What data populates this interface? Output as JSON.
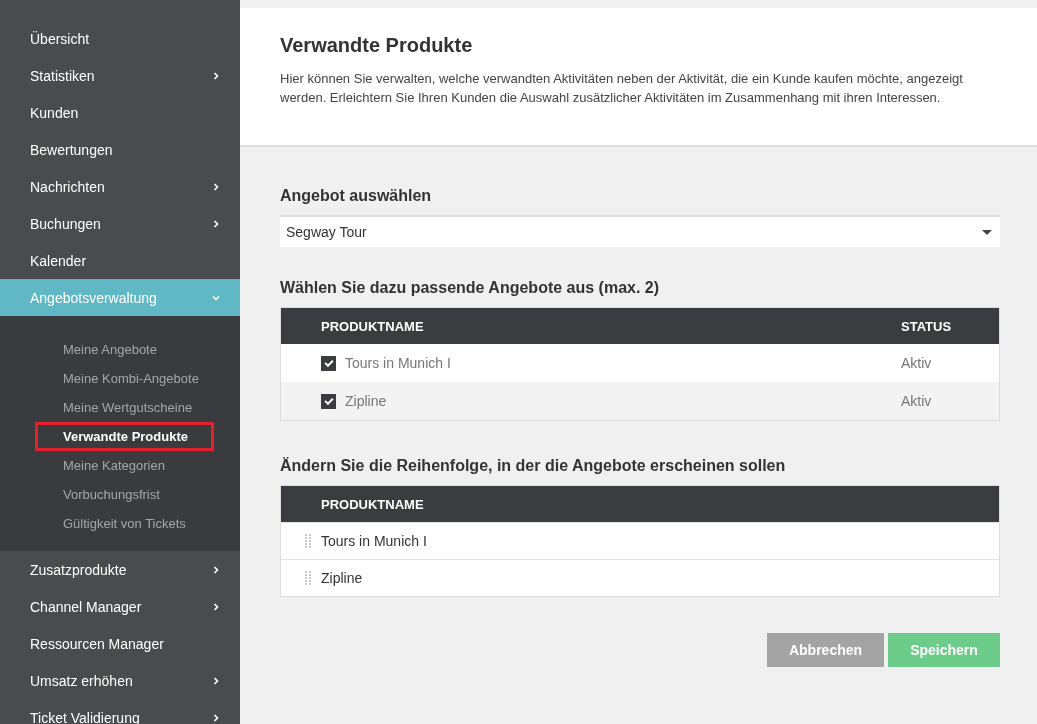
{
  "sidebar": {
    "items": [
      {
        "label": "Übersicht",
        "selected": false
      },
      {
        "label": "Statistiken",
        "expanded": false,
        "selected": false
      },
      {
        "label": "Kunden",
        "selected": false
      },
      {
        "label": "Bewertungen",
        "selected": false
      },
      {
        "label": "Nachrichten",
        "expanded": false,
        "selected": false
      },
      {
        "label": "Buchungen",
        "expanded": false,
        "selected": false
      },
      {
        "label": "Kalender",
        "selected": false
      },
      {
        "label": "Angebotsverwaltung",
        "expanded": true,
        "selected": true,
        "children": [
          {
            "label": "Meine Angebote",
            "selected": false
          },
          {
            "label": "Meine Kombi-Angebote",
            "selected": false
          },
          {
            "label": "Meine Wertgutscheine",
            "selected": false
          },
          {
            "label": "Verwandte Produkte",
            "selected": true
          },
          {
            "label": "Meine Kategorien",
            "selected": false
          },
          {
            "label": "Vorbuchungsfrist",
            "selected": false
          },
          {
            "label": "Gültigkeit von Tickets",
            "selected": false
          }
        ]
      },
      {
        "label": "Zusatzprodukte",
        "expanded": false,
        "selected": false
      },
      {
        "label": "Channel Manager",
        "expanded": false,
        "selected": false
      },
      {
        "label": "Ressourcen Manager",
        "selected": false
      },
      {
        "label": "Umsatz erhöhen",
        "expanded": false,
        "selected": false
      },
      {
        "label": "Ticket Validierung",
        "expanded": false,
        "selected": false
      }
    ]
  },
  "header": {
    "title": "Verwandte Produkte",
    "description": "Hier können Sie verwalten, welche verwandten Aktivitäten neben der Aktivität, die ein Kunde kaufen möchte, angezeigt werden. Erleichtern Sie Ihren Kunden die Auswahl zusätzlicher Aktivitäten im Zusammenhang mit ihren Interessen."
  },
  "offer_select": {
    "label": "Angebot auswählen",
    "value": "Segway Tour"
  },
  "related_table": {
    "title": "Wählen Sie dazu passende Angebote aus (max. 2)",
    "columns": [
      "PRODUKTNAME",
      "STATUS"
    ],
    "rows": [
      {
        "name": "Tours in Munich I",
        "status": "Aktiv",
        "checked": true
      },
      {
        "name": "Zipline",
        "status": "Aktiv",
        "checked": true
      }
    ]
  },
  "order_table": {
    "title": "Ändern Sie die Reihenfolge, in der die Angebote erscheinen sollen",
    "columns": [
      "PRODUKTNAME"
    ],
    "rows": [
      {
        "name": "Tours in Munich I"
      },
      {
        "name": "Zipline"
      }
    ]
  },
  "buttons": [
    {
      "label": "Abbrechen",
      "kind": "cancel"
    },
    {
      "label": "Speichern",
      "kind": "save"
    }
  ]
}
